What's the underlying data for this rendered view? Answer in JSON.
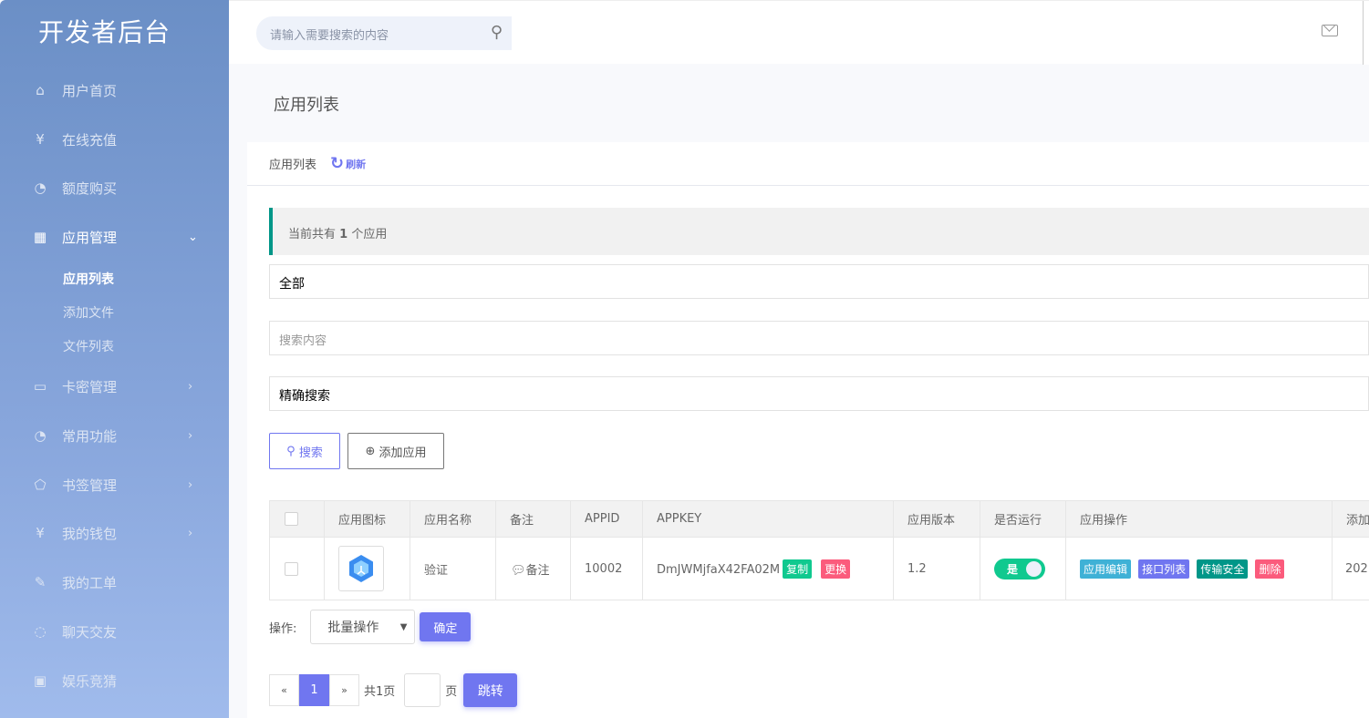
{
  "sidebar": {
    "logo": "开发者后台",
    "items": [
      {
        "label": "用户首页",
        "icon": "home-icon"
      },
      {
        "label": "在线充值",
        "icon": "yen-icon"
      },
      {
        "label": "额度购买",
        "icon": "gauge-icon"
      },
      {
        "label": "应用管理",
        "icon": "apps-icon"
      },
      {
        "label": "卡密管理",
        "icon": "card-icon"
      },
      {
        "label": "常用功能",
        "icon": "gauge-icon"
      },
      {
        "label": "书签管理",
        "icon": "tag-icon"
      },
      {
        "label": "我的钱包",
        "icon": "yen-icon"
      },
      {
        "label": "我的工单",
        "icon": "ticket-icon"
      },
      {
        "label": "聊天交友",
        "icon": "chat-icon"
      },
      {
        "label": "娱乐竞猜",
        "icon": "gift-icon"
      }
    ],
    "subitems": [
      "应用列表",
      "添加文件",
      "文件列表"
    ]
  },
  "header": {
    "search_placeholder": "请输入需要搜索的内容"
  },
  "page": {
    "title": "应用列表"
  },
  "card": {
    "title": "应用列表",
    "refresh": "刷新",
    "notice_prefix": "当前共有",
    "notice_count": "1",
    "notice_suffix": "个应用",
    "filter_select": "全部",
    "search_placeholder": "搜索内容",
    "search_mode": "精确搜索",
    "search_button": "搜索",
    "add_button": "添加应用"
  },
  "table": {
    "headers": [
      "应用图标",
      "应用名称",
      "备注",
      "APPID",
      "APPKEY",
      "应用版本",
      "是否运行",
      "应用操作",
      "添加"
    ],
    "rows": [
      {
        "name": "验证",
        "note": "备注",
        "appid": "10002",
        "appkey": "DmJWMjfaX42FA02M",
        "copy": "复制",
        "change": "更换",
        "version": "1.2",
        "running": "是",
        "actions": [
          "应用编辑",
          "接口列表",
          "传输安全",
          "删除"
        ],
        "added": "202"
      }
    ]
  },
  "colors": {
    "edit": "#3fb1d6",
    "api": "#7076f0",
    "security": "#009688",
    "delete": "#fb5b7c",
    "copy": "#10c98f",
    "accent": "#7076f0"
  },
  "batch": {
    "label": "操作:",
    "select": "批量操作",
    "confirm": "确定"
  },
  "pager": {
    "prev": "«",
    "current": "1",
    "next": "»",
    "total": "共1页",
    "page_unit": "页",
    "jump": "跳转"
  }
}
